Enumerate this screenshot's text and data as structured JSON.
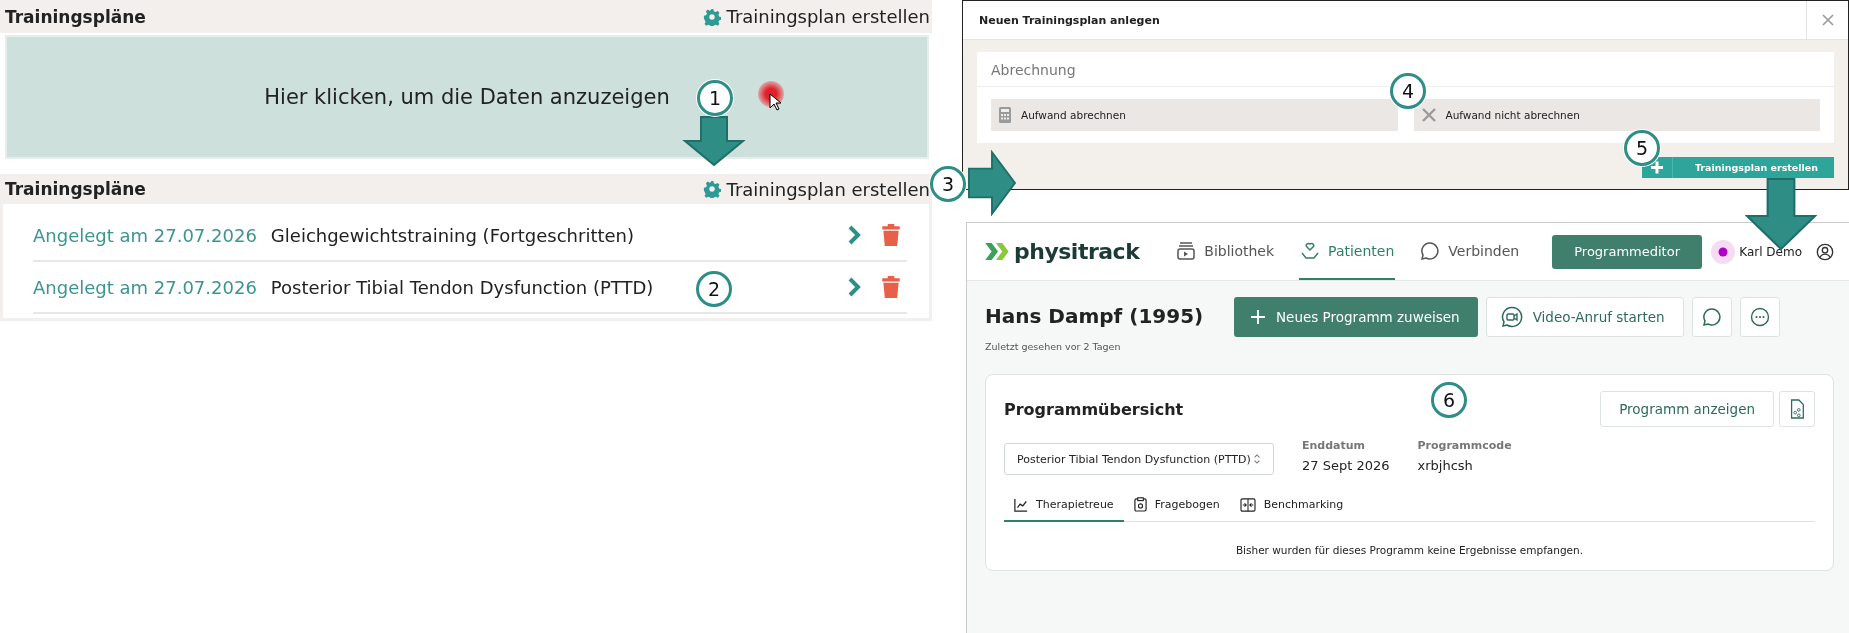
{
  "panel_1": {
    "title": "Trainingspläne",
    "action": "Trainingsplan erstellen",
    "message": "Hier klicken, um die Daten anzuzeigen"
  },
  "panel_2": {
    "title": "Trainingspläne",
    "action": "Trainingsplan erstellen",
    "rows": [
      {
        "date": "Angelegt am 27.07.2026",
        "name": "Gleichgewichtstraining (Fortgeschritten)"
      },
      {
        "date": "Angelegt am 27.07.2026",
        "name": "Posterior Tibial Tendon Dysfunction (PTTD)"
      }
    ]
  },
  "dialog": {
    "title": "Neuen Trainingsplan anlegen",
    "section": "Abrechnung",
    "options": [
      {
        "label": "Aufwand abrechnen",
        "kind": "calculator"
      },
      {
        "label": "Aufwand nicht abrechnen",
        "kind": "cross"
      }
    ],
    "submit": "Trainingsplan erstellen"
  },
  "app": {
    "logo": "physitrack",
    "nav": [
      {
        "label": "Bibliothek",
        "kind": "library",
        "selected": false
      },
      {
        "label": "Patienten",
        "kind": "patients",
        "selected": true
      },
      {
        "label": "Verbinden",
        "kind": "chat",
        "selected": false
      }
    ],
    "editor_button": "Programmeditor",
    "user": "Karl Demo",
    "patient": {
      "name": "Hans Dampf (1995)",
      "last_seen": "Zuletzt gesehen vor 2 Tagen"
    },
    "assign_button": "Neues Programm zuweisen",
    "video_button": "Video-Anruf starten",
    "overview": {
      "title": "Programmübersicht",
      "show_button": "Programm anzeigen",
      "program_select": "Posterior Tibial Tendon Dysfunction (PTTD)",
      "fields": [
        {
          "label": "Enddatum",
          "value": "27 Sept 2026"
        },
        {
          "label": "Programmcode",
          "value": "xrbjhcsh"
        }
      ],
      "tabs": [
        {
          "label": "Therapietreue",
          "kind": "chart",
          "selected": true
        },
        {
          "label": "Fragebogen",
          "kind": "clipboard",
          "selected": false
        },
        {
          "label": "Benchmarking",
          "kind": "compare",
          "selected": false
        }
      ],
      "empty_message": "Bisher wurden für dieses Programm keine Ergebnisse empfangen."
    }
  },
  "annotations": [
    {
      "label": "1"
    },
    {
      "label": "2"
    },
    {
      "label": "3"
    },
    {
      "label": "4"
    },
    {
      "label": "5"
    },
    {
      "label": "6"
    }
  ]
}
